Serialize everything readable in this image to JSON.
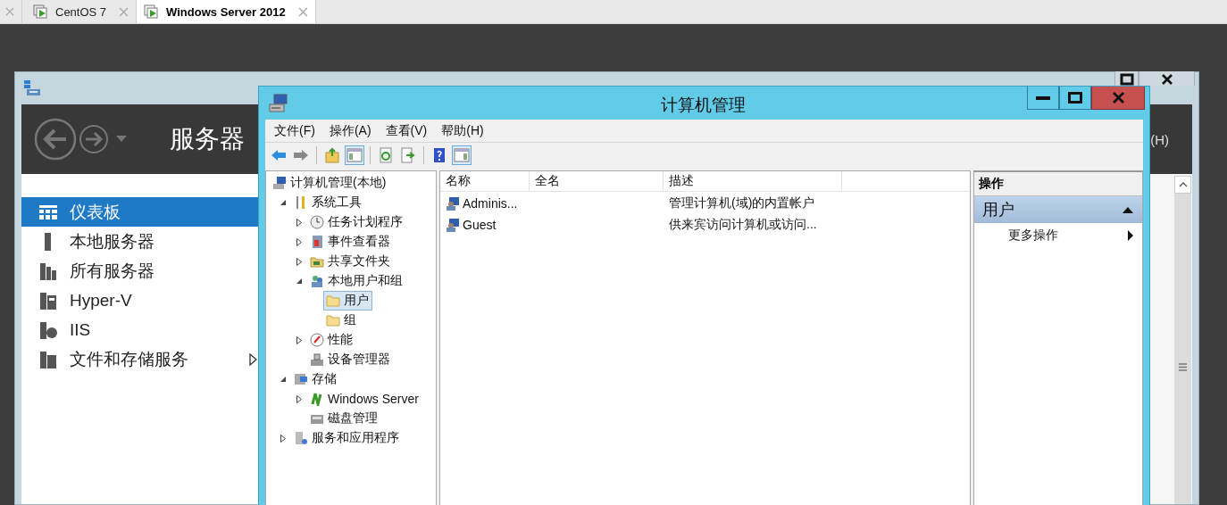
{
  "host_tabs": [
    {
      "label": "CentOS 7",
      "selected": false
    },
    {
      "label": "Windows Server 2012",
      "selected": true
    }
  ],
  "server_manager": {
    "header_title": "服务器",
    "header_menu_fragment": "(H)",
    "nav": [
      {
        "label": "仪表板",
        "selected": true,
        "has_submenu": false
      },
      {
        "label": "本地服务器",
        "selected": false,
        "has_submenu": false
      },
      {
        "label": "所有服务器",
        "selected": false,
        "has_submenu": false
      },
      {
        "label": "Hyper-V",
        "selected": false,
        "has_submenu": false
      },
      {
        "label": "IIS",
        "selected": false,
        "has_submenu": false
      },
      {
        "label": "文件和存储服务",
        "selected": false,
        "has_submenu": true
      }
    ]
  },
  "computer_management": {
    "title": "计算机管理",
    "menu": [
      "文件(F)",
      "操作(A)",
      "查看(V)",
      "帮助(H)"
    ],
    "toolbar": [
      {
        "kind": "back",
        "pressed": false
      },
      {
        "kind": "forward",
        "pressed": false
      },
      {
        "kind": "separator"
      },
      {
        "kind": "up",
        "pressed": false
      },
      {
        "kind": "tree-pane",
        "pressed": true
      },
      {
        "kind": "separator"
      },
      {
        "kind": "refresh",
        "pressed": false
      },
      {
        "kind": "export",
        "pressed": false
      },
      {
        "kind": "separator"
      },
      {
        "kind": "help",
        "pressed": false
      },
      {
        "kind": "action-pane",
        "pressed": true
      }
    ],
    "tree": [
      {
        "label": "计算机管理(本地)",
        "selected": false,
        "children": [
          {
            "label": "系统工具",
            "selected": false,
            "expanded": true,
            "children": [
              {
                "label": "任务计划程序",
                "selected": false,
                "expanded": false
              },
              {
                "label": "事件查看器",
                "selected": false,
                "expanded": false
              },
              {
                "label": "共享文件夹",
                "selected": false,
                "expanded": false
              },
              {
                "label": "本地用户和组",
                "selected": false,
                "expanded": true,
                "children": [
                  {
                    "label": "用户",
                    "selected": true
                  },
                  {
                    "label": "组",
                    "selected": false
                  }
                ]
              },
              {
                "label": "性能",
                "selected": false,
                "expanded": false
              },
              {
                "label": "设备管理器",
                "selected": false
              }
            ]
          },
          {
            "label": "存储",
            "selected": false,
            "expanded": true,
            "children": [
              {
                "label": "Windows Server",
                "selected": false,
                "expanded": false
              },
              {
                "label": "磁盘管理",
                "selected": false
              }
            ]
          },
          {
            "label": "服务和应用程序",
            "selected": false,
            "expanded": false
          }
        ]
      }
    ],
    "list": {
      "columns": [
        "名称",
        "全名",
        "描述"
      ],
      "rows": [
        {
          "name": "Adminis...",
          "description": "管理计算机(域)的内置帐户",
          "selected": false
        },
        {
          "name": "Guest",
          "description": "供来宾访问计算机或访问...",
          "selected": false
        }
      ]
    },
    "actions": {
      "header": "操作",
      "groups": [
        {
          "label": "用户",
          "expanded": true,
          "items": [
            {
              "label": "更多操作",
              "has_submenu": true
            }
          ]
        }
      ]
    }
  }
}
